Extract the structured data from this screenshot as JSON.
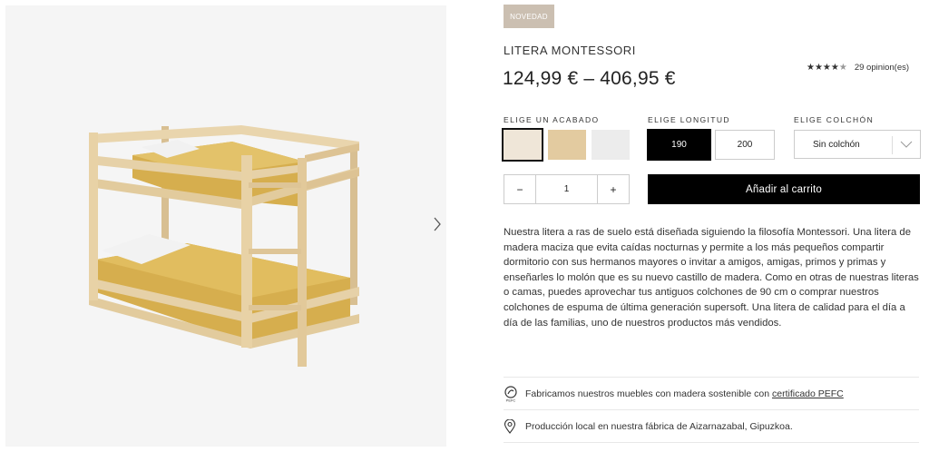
{
  "badge": "NOVEDAD",
  "product": {
    "title": "LITERA MONTESSORI",
    "price": "124,99 € – 406,95 €",
    "rating": {
      "stars": 4.5,
      "reviews_text": "29 opinion(es)"
    }
  },
  "finish": {
    "label": "ELIGE UN ACABADO",
    "swatches": [
      {
        "name": "natural",
        "color": "#efe6d8",
        "selected": true
      },
      {
        "name": "honey",
        "color": "#e3cba0",
        "selected": false
      },
      {
        "name": "white",
        "color": "#ececec",
        "selected": false
      }
    ]
  },
  "length": {
    "label": "ELIGE LONGITUD",
    "options": [
      {
        "label": "190",
        "selected": true
      },
      {
        "label": "200",
        "selected": false
      }
    ]
  },
  "mattress": {
    "label": "ELIGE COLCHÓN",
    "selected": "Sin colchón"
  },
  "quantity": {
    "minus": "−",
    "value": "1",
    "plus": "+"
  },
  "cart_button": "Añadir al carrito",
  "description": "Nuestra litera a ras de suelo está diseñada siguiendo la filosofía Montessori. Una litera de madera maciza que evita caídas nocturnas y permite a los más pequeños compartir dormitorio con sus hermanos mayores o invitar a amigos, amigas, primos y primas y enseñarles lo molón que es su nuevo castillo de madera. Como en otras de nuestras literas o camas, puedes aprovechar tus antiguos colchones de 90 cm o comprar nuestros colchones de espuma de última generación supersoft. Una litera de calidad para el día a día de las familias, uno de nuestros productos más vendidos.",
  "features": [
    {
      "icon": "pefc-icon",
      "text": "Fabricamos nuestros muebles con madera sostenible con ",
      "link": "certificado PEFC"
    },
    {
      "icon": "location-pin-icon",
      "text": "Producción local en nuestra fábrica de Aizarnazabal, Gipuzkoa.",
      "link": ""
    }
  ],
  "colors": {
    "accent": "#000000",
    "badge_bg": "#cbbfb1",
    "wood": "#e4cfa6",
    "mattress": "#d9b04a"
  }
}
